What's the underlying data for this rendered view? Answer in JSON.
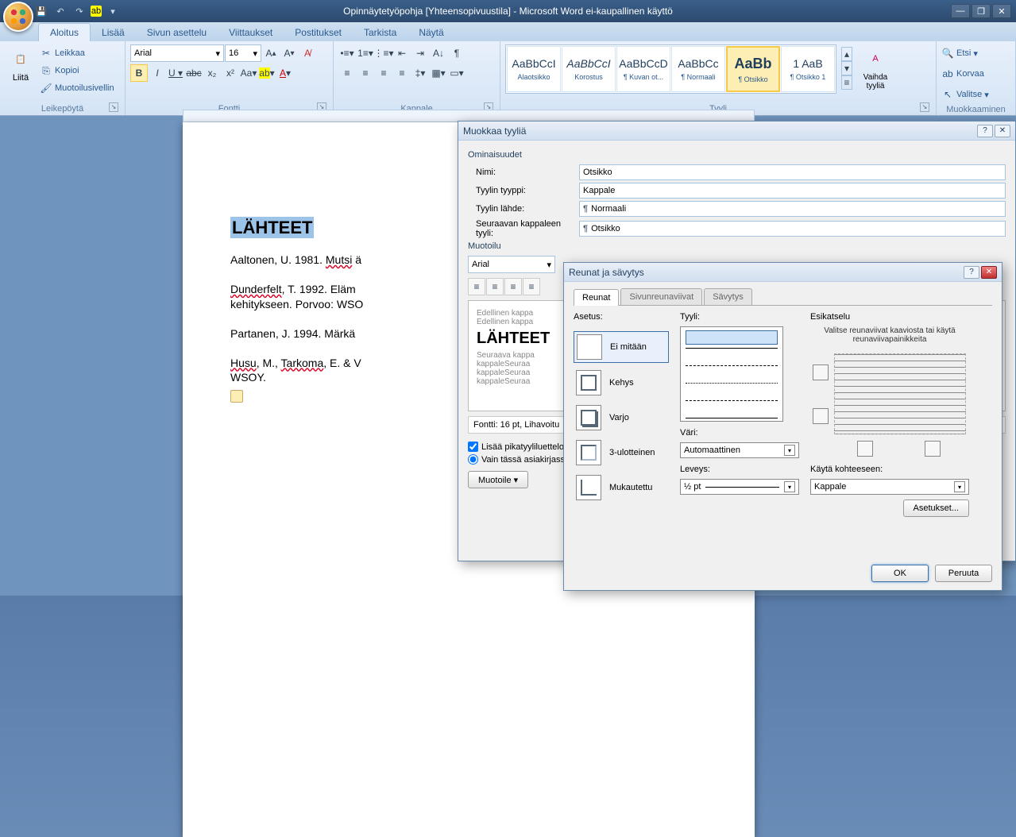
{
  "title": "Opinnäytetyöpohja [Yhteensopivuustila] - Microsoft Word ei-kaupallinen käyttö",
  "ribbon": {
    "tabs": [
      "Aloitus",
      "Lisää",
      "Sivun asettelu",
      "Viittaukset",
      "Postitukset",
      "Tarkista",
      "Näytä"
    ],
    "active": 0,
    "clipboard": {
      "label": "Leikepöytä",
      "paste": "Liitä",
      "cut": "Leikkaa",
      "copy": "Kopioi",
      "fmtpainter": "Muotoilusivellin"
    },
    "font": {
      "label": "Fontti",
      "name": "Arial",
      "size": "16"
    },
    "paragraph": {
      "label": "Kappale"
    },
    "styles": {
      "label": "Tyyli",
      "items": [
        {
          "preview": "AaBbCcI",
          "name": "Alaotsikko"
        },
        {
          "preview": "AaBbCcI",
          "name": "Korostus",
          "italic": true
        },
        {
          "preview": "AaBbCcD",
          "name": "¶ Kuvan ot..."
        },
        {
          "preview": "AaBbCc",
          "name": "¶ Normaali"
        },
        {
          "preview": "AaBb",
          "name": "¶ Otsikko",
          "selected": true,
          "bold": true
        },
        {
          "preview": "1 AaB",
          "name": "¶ Otsikko 1"
        }
      ],
      "change": "Vaihda tyyliä"
    },
    "editing": {
      "label": "Muokkaaminen",
      "find": "Etsi",
      "replace": "Korvaa",
      "select": "Valitse"
    }
  },
  "document": {
    "heading": "LÄHTEET",
    "p1a": "Aaltonen, U. 1981. ",
    "p1b": "Mutsi",
    "p1c": " ä",
    "p2a": "Dunderfelt",
    "p2b": ", T. 1992. Eläm",
    "p2c": "kehitykseen. Porvoo: WSO",
    "p3": "Partanen, J. 1994. Märkä",
    "p4a": "Husu",
    "p4b": ", M., ",
    "p4c": "Tarkoma",
    "p4d": ", E. & V",
    "p4e": "WSOY."
  },
  "modStyle": {
    "title": "Muokkaa tyyliä",
    "properties": "Ominaisuudet",
    "nameLbl": "Nimi:",
    "nameVal": "Otsikko",
    "typeLbl": "Tyylin tyyppi:",
    "typeVal": "Kappale",
    "basedLbl": "Tyylin lähde:",
    "basedVal": "Normaali",
    "nextLbl": "Seuraavan kappaleen tyyli:",
    "nextVal": "Otsikko",
    "formatting": "Muotoilu",
    "fontName": "Arial",
    "prevBefore": "Edellinen kappa\nEdellinen kappa",
    "prevMain": "LÄHTEET",
    "prevAfter": "Seuraava kappa\nkappaleSeuraa\nkappaleSeuraa\nkappaleSeuraa",
    "fontDesc": "Fontti: 16 pt, Lihavoitu",
    "quickStyle": "Lisää pikatyyliluettelo",
    "docOnly": "Vain tässä asiakirjass",
    "formatBtn": "Muotoile"
  },
  "borders": {
    "title": "Reunat ja sävytys",
    "tabs": [
      "Reunat",
      "Sivunreunaviivat",
      "Sävytys"
    ],
    "settingLbl": "Asetus:",
    "settings": [
      "Ei mitään",
      "Kehys",
      "Varjo",
      "3-ulotteinen",
      "Mukautettu"
    ],
    "styleLbl": "Tyyli:",
    "colorLbl": "Väri:",
    "colorVal": "Automaattinen",
    "widthLbl": "Leveys:",
    "widthVal": "½ pt",
    "previewLbl": "Esikatselu",
    "previewHint": "Valitse reunaviivat kaaviosta tai käytä reunaviivapainikkeita",
    "applyLbl": "Käytä kohteeseen:",
    "applyVal": "Kappale",
    "options": "Asetukset...",
    "ok": "OK",
    "cancel": "Peruuta"
  }
}
